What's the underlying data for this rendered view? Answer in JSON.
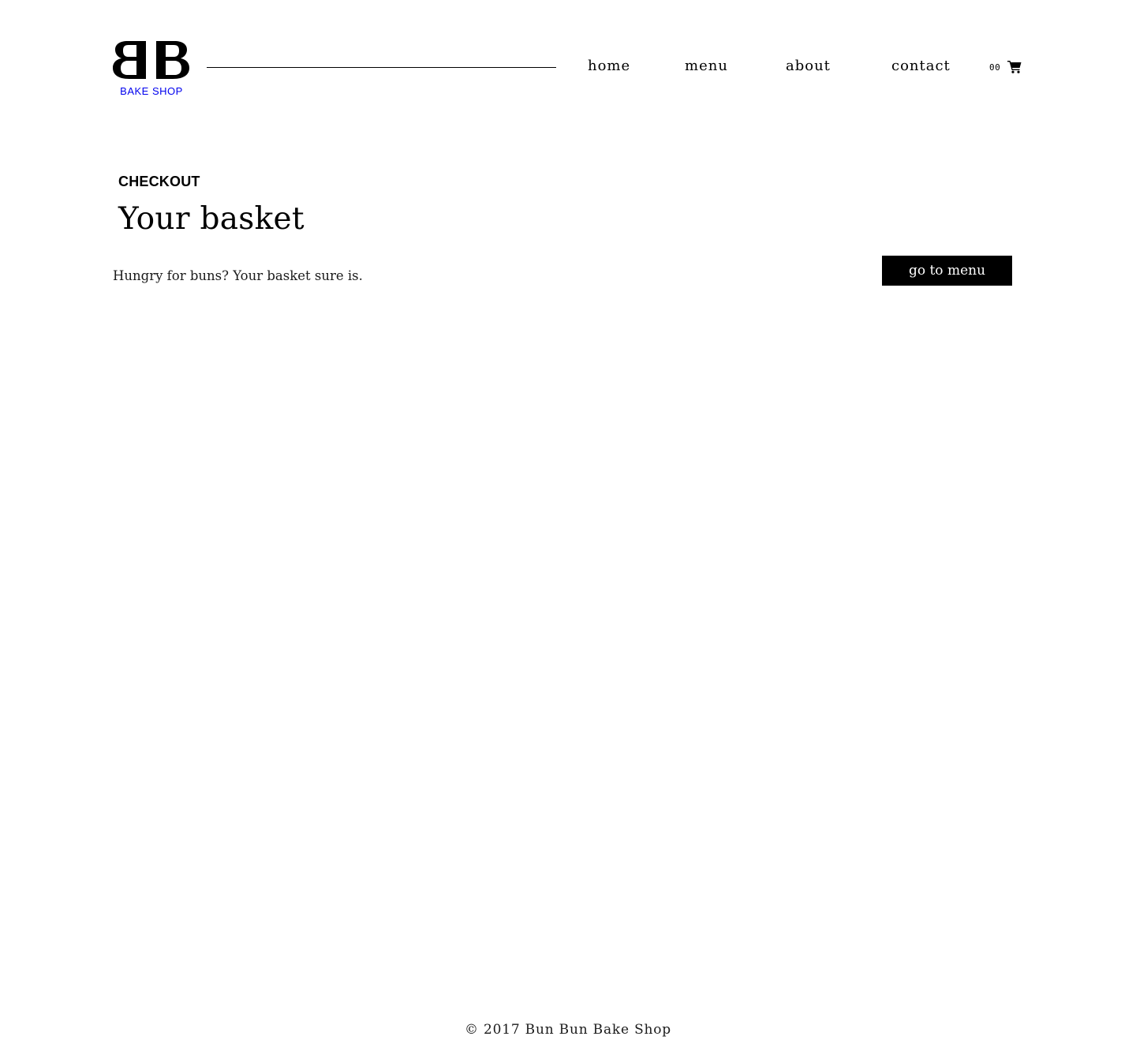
{
  "header": {
    "logo": {
      "mark": "BB",
      "tagline": "BAKE SHOP"
    },
    "nav": [
      {
        "label": "home"
      },
      {
        "label": "menu"
      },
      {
        "label": "about"
      },
      {
        "label": "contact"
      }
    ],
    "cart": {
      "count": "00",
      "icon": "shopping-cart-icon"
    }
  },
  "main": {
    "eyebrow": "CHECKOUT",
    "title": "Your basket",
    "subtitle": "Hungry for buns? Your basket sure is.",
    "button_label": "go to menu"
  },
  "footer": {
    "copyright": "© 2017 Bun Bun Bake Shop"
  },
  "colors": {
    "background": "#ffffff",
    "text": "#000000",
    "button_bg": "#000000",
    "button_text": "#ffffff"
  }
}
